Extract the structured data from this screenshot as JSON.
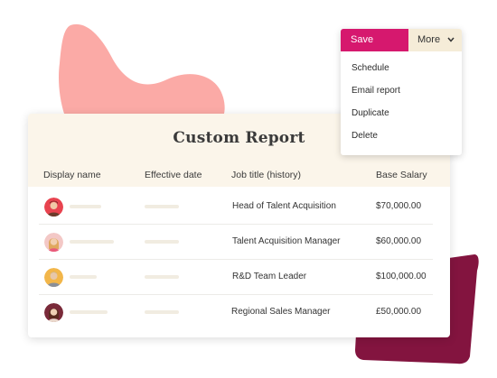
{
  "colors": {
    "accent": "#d6186e",
    "pink_blob": "#fbaaa6",
    "maroon_blob": "#83143f",
    "header_bg": "#fbf5ea",
    "more_bg": "#f5ecd8"
  },
  "actions": {
    "save_label": "Save",
    "more_label": "More",
    "menu_items": [
      "Schedule",
      "Email report",
      "Duplicate",
      "Delete"
    ]
  },
  "report": {
    "title": "Custom Report",
    "columns": [
      "Display name",
      "Effective date",
      "Job title (history)",
      "Base Salary"
    ],
    "rows": [
      {
        "job_title": "Head of Talent Acquisition",
        "salary": "$70,000.00"
      },
      {
        "job_title": "Talent Acquisition Manager",
        "salary": "$60,000.00"
      },
      {
        "job_title": "R&D Team Leader",
        "salary": "$100,000.00"
      },
      {
        "job_title": "Regional Sales Manager",
        "salary": "£50,000.00"
      }
    ]
  }
}
